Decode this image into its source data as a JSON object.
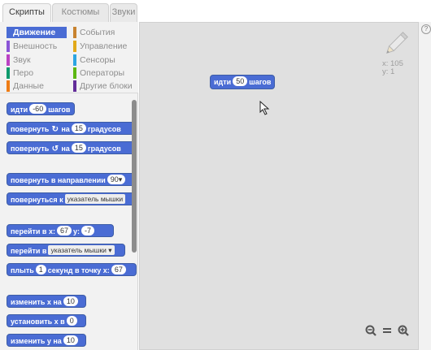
{
  "tabs": [
    "Скрипты",
    "Костюмы",
    "Звуки"
  ],
  "categories": {
    "left": [
      {
        "label": "Движение",
        "color": "#4a6cd4"
      },
      {
        "label": "Внешность",
        "color": "#8a55d7"
      },
      {
        "label": "Звук",
        "color": "#bb42c3"
      },
      {
        "label": "Перо",
        "color": "#0e9a6c"
      },
      {
        "label": "Данные",
        "color": "#ee7d16"
      }
    ],
    "right": [
      {
        "label": "События",
        "color": "#c88330"
      },
      {
        "label": "Управление",
        "color": "#e1a91a"
      },
      {
        "label": "Сенсоры",
        "color": "#2ca5e2"
      },
      {
        "label": "Операторы",
        "color": "#5cb712"
      },
      {
        "label": "Другие блоки",
        "color": "#632d99"
      }
    ]
  },
  "blocks": {
    "move": {
      "pre": "идти",
      "val": "-60",
      "post": "шагов"
    },
    "turn_cw": {
      "pre": "повернуть",
      "mid": "на",
      "val": "15",
      "post": "градусов"
    },
    "turn_ccw": {
      "pre": "повернуть",
      "mid": "на",
      "val": "15",
      "post": "градусов"
    },
    "point_dir": {
      "pre": "повернуть в направлении",
      "val": "90▾"
    },
    "point_to": {
      "pre": "повернуться к",
      "dd": "указатель мышки"
    },
    "goto_xy": {
      "pre": "перейти в x:",
      "x": "67",
      "ylbl": "y:",
      "y": "-7"
    },
    "goto": {
      "pre": "перейти в",
      "dd": "указатель мышки ▾"
    },
    "glide": {
      "pre": "плыть",
      "val": "1",
      "mid": "секунд в точку x:",
      "x": "67"
    },
    "change_x": {
      "pre": "изменить х на",
      "val": "10"
    },
    "set_x": {
      "pre": "установить х в",
      "val": "0"
    },
    "change_y": {
      "pre": "изменить у на",
      "val": "10"
    }
  },
  "script": {
    "pre": "идти",
    "val": "50",
    "post": "шагов"
  },
  "coords": {
    "x": "x: 105",
    "y": "y: 1"
  },
  "help": "?"
}
